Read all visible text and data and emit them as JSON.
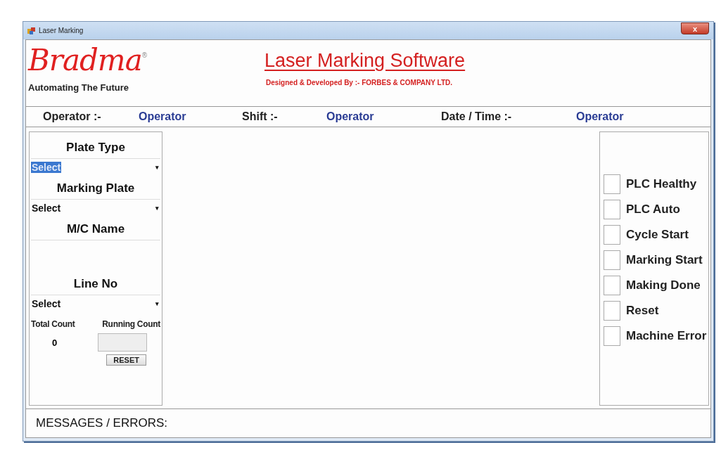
{
  "window": {
    "title": "Laser Marking",
    "close": "x"
  },
  "header": {
    "logo": "Bradma",
    "logo_mark": "®",
    "tagline": "Automating The Future",
    "title": "Laser Marking Software",
    "subtitle": "Designed & Developed By :- FORBES & COMPANY LTD."
  },
  "info_bar": [
    {
      "label": "Operator :-",
      "value": "Operator"
    },
    {
      "label": "Shift :-",
      "value": "Operator"
    },
    {
      "label": "Date / Time :-",
      "value": "Operator"
    }
  ],
  "left_panel": {
    "fields": [
      {
        "kind": "dropdown",
        "label": "Plate Type",
        "value": "Select",
        "highlighted": true,
        "arrow": "▾"
      },
      {
        "kind": "dropdown",
        "label": "Marking Plate",
        "value": "Select",
        "highlighted": false,
        "arrow": "▾"
      },
      {
        "kind": "blank",
        "label": "M/C Name"
      },
      {
        "kind": "dropdown",
        "label": "Line No",
        "value": "Select",
        "highlighted": false,
        "arrow": "▾"
      }
    ],
    "total_count": {
      "label": "Total Count",
      "value": "0"
    },
    "running_count": {
      "label": "Running Count"
    },
    "reset_button": "RESET"
  },
  "indicators": [
    {
      "label": "PLC Healthy",
      "on": false
    },
    {
      "label": "PLC Auto",
      "on": false
    },
    {
      "label": "Cycle Start",
      "on": false
    },
    {
      "label": "Marking Start",
      "on": false
    },
    {
      "label": "Making Done",
      "on": false
    },
    {
      "label": "Reset",
      "on": false
    },
    {
      "label": "Machine Error",
      "on": false
    }
  ],
  "messages": {
    "label": "MESSAGES / ERRORS:"
  }
}
